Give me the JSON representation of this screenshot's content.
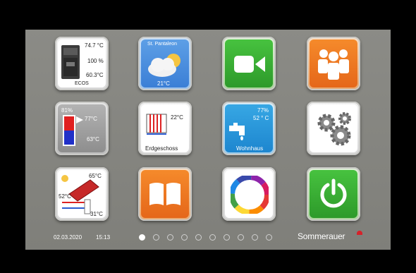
{
  "status": {
    "date": "02.03.2020",
    "time": "15:13"
  },
  "brand": {
    "name": "Sommerauer"
  },
  "pagination": {
    "count": 10,
    "active": 0
  },
  "tiles": {
    "boiler": {
      "temp_top": "74.7 °C",
      "percent": "100 %",
      "temp_bottom": "60.3°C",
      "name": "ECOS",
      "icon": "boiler-icon"
    },
    "weather": {
      "location": "St. Pantaleon",
      "temp": "21°C",
      "icon": "cloud-sun-icon"
    },
    "video": {
      "icon": "video-camera-icon"
    },
    "users": {
      "icon": "users-group-icon"
    },
    "buffer": {
      "percent": "81%",
      "temp_top": "77°C",
      "temp_bottom": "63°C",
      "icon": "buffer-tank-icon"
    },
    "heating": {
      "temp": "22°C",
      "name": "Erdgeschoss",
      "icon": "radiator-icon"
    },
    "water": {
      "percent": "77%",
      "temp": "52 ° C",
      "name": "Wohnhaus",
      "icon": "faucet-icon"
    },
    "settings": {
      "icon": "gears-icon"
    },
    "solar": {
      "temp_top": "65°C",
      "temp_left": "52°C",
      "temp_bottom": "31°C",
      "icon": "solar-collector-icon"
    },
    "manual": {
      "icon": "book-icon"
    },
    "apps": {
      "icon": "puzzle-wheel-icon"
    },
    "power": {
      "icon": "power-icon"
    }
  },
  "colors": {
    "accent_red": "#d6222a",
    "green": "#3bb035",
    "orange": "#f07a25",
    "blue": "#2f8fd8"
  }
}
